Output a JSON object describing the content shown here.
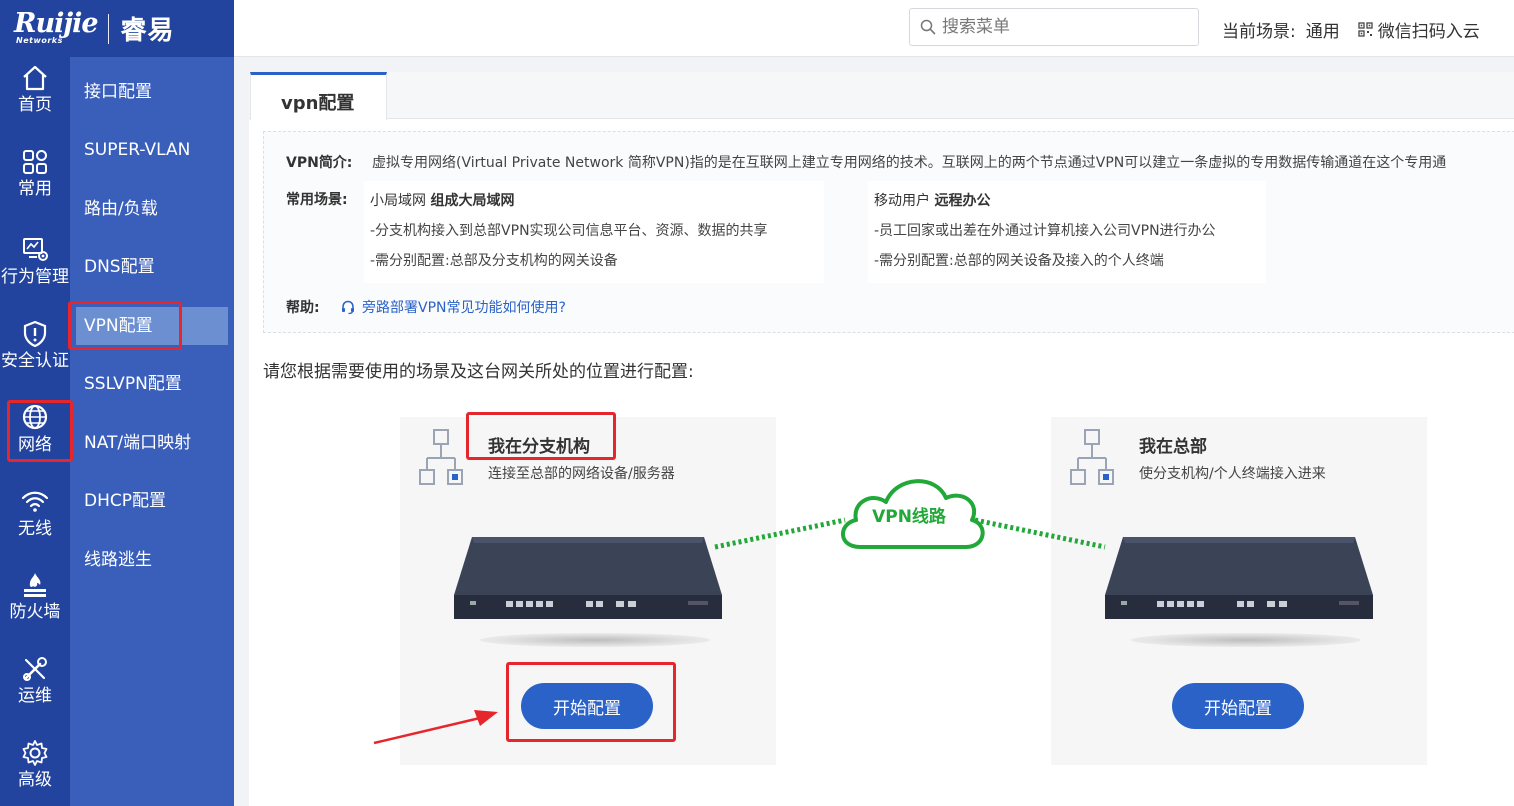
{
  "brand": {
    "logo_text": "Ruijie",
    "logo_subtext": "Networks",
    "product_name": "睿易"
  },
  "header": {
    "search_placeholder": "搜索菜单",
    "scene_label": "当前场景:",
    "scene_value": "通用",
    "wechat_label": "微信扫码入云"
  },
  "rail": {
    "items": [
      {
        "label": "首页",
        "icon": "home-icon"
      },
      {
        "label": "常用",
        "icon": "grid-icon"
      },
      {
        "label": "行为管理",
        "icon": "monitor-icon"
      },
      {
        "label": "安全认证",
        "icon": "shield-icon"
      },
      {
        "label": "网络",
        "icon": "globe-icon"
      },
      {
        "label": "无线",
        "icon": "wifi-icon"
      },
      {
        "label": "防火墙",
        "icon": "firewall-icon"
      },
      {
        "label": "运维",
        "icon": "tools-icon"
      },
      {
        "label": "高级",
        "icon": "gear-icon"
      }
    ],
    "active": "网络"
  },
  "submenu": {
    "items": [
      "接口配置",
      "SUPER-VLAN",
      "路由/负载",
      "DNS配置",
      "VPN配置",
      "SSLVPN配置",
      "NAT/端口映射",
      "DHCP配置",
      "线路逃生"
    ],
    "active": "VPN配置"
  },
  "tab": {
    "label": "vpn配置"
  },
  "intro": {
    "vpn_key": "VPN简介:",
    "vpn_text": "虚拟专用网络(Virtual Private Network 简称VPN)指的是在互联网上建立专用网络的技术。互联网上的两个节点通过VPN可以建立一条虚拟的专用数据传输通道在这个专用通",
    "scenario_key": "常用场景:",
    "scenarios": [
      {
        "prefix": "小局域网",
        "bold": "组成大局域网",
        "lines": [
          "-分支机构接入到总部VPN实现公司信息平台、资源、数据的共享",
          "-需分别配置:总部及分支机构的网关设备"
        ]
      },
      {
        "prefix": "移动用户",
        "bold": "远程办公",
        "lines": [
          "-员工回家或出差在外通过计算机接入公司VPN进行办公",
          "-需分别配置:总部的网关设备及接入的个人终端"
        ]
      }
    ],
    "help_key": "帮助:",
    "help_link": "旁路部署VPN常见功能如何使用?"
  },
  "instruction": "请您根据需要使用的场景及这台网关所处的位置进行配置:",
  "cards": [
    {
      "title": "我在分支机构",
      "desc": "连接至总部的网络设备/服务器",
      "button": "开始配置"
    },
    {
      "title": "我在总部",
      "desc": "使分支机构/个人终端接入进来",
      "button": "开始配置"
    }
  ],
  "vpn_cloud_label": "VPN线路",
  "colors": {
    "rail": "#22449e",
    "submenu": "#3a5fba",
    "submenu_active": "#6b8fd1",
    "primary": "#2b62c8",
    "vpn_green": "#21a838",
    "annotation": "#e5262d"
  }
}
